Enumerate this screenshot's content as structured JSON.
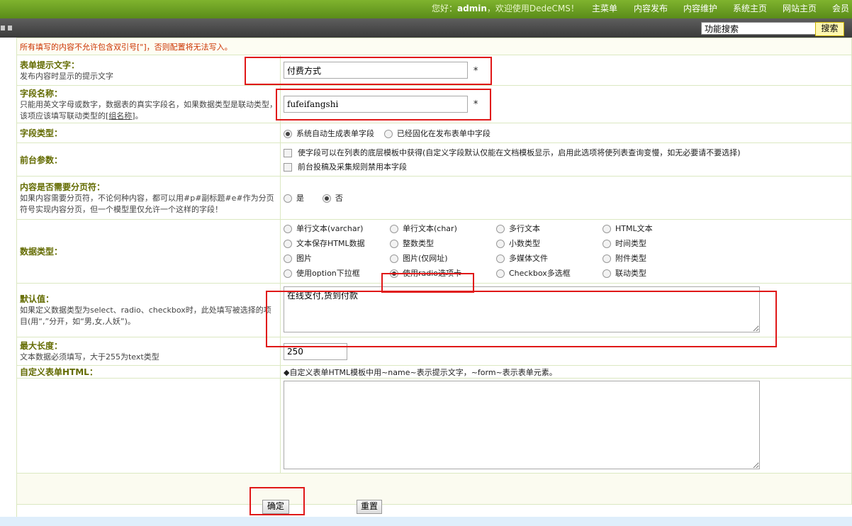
{
  "header": {
    "greeting_prefix": "您好：",
    "username": "admin",
    "greeting_suffix": "，欢迎使用DedeCMS！",
    "nav": [
      "主菜单",
      "内容发布",
      "内容维护",
      "系统主页",
      "网站主页",
      "会员"
    ]
  },
  "toolbar": {
    "search_value": "功能搜索",
    "search_button": "搜索"
  },
  "form": {
    "warning": "所有填写的内容不允许包含双引号[\"]，否则配置将无法写入。",
    "itemname": {
      "title": "表单提示文字：",
      "desc": "发布内容时显示的提示文字",
      "value": "付费方式",
      "required": "*"
    },
    "fieldname": {
      "title": "字段名称：",
      "desc": "只能用英文字母或数字，数据表的真实字段名，如果数据类型是联动类型，该项应该填写联动类型的",
      "desc_link": "[组名称]",
      "desc_end": "。",
      "value": "fufeifangshi",
      "required": "*"
    },
    "fieldtype": {
      "title": "字段类型：",
      "options": [
        "系统自动生成表单字段",
        "已经固化在发布表单中字段"
      ],
      "selected": 0
    },
    "frontparams": {
      "title": "前台参数：",
      "options": [
        "使字段可以在列表的底层模板中获得(自定义字段默认仅能在文档模板显示，启用此选项将使列表查询变慢，如无必要请不要选择)",
        "前台投稿及采集规则禁用本字段"
      ]
    },
    "pagebreak": {
      "title": "内容是否需要分页符：",
      "desc": "如果内容需要分页符，不论何种内容，都可以用#p#副标题#e#作为分页符号实现内容分页，但一个模型里仅允许一个这样的字段！",
      "options": [
        "是",
        "否"
      ],
      "selected": 1
    },
    "datatype": {
      "title": "数据类型：",
      "options": [
        "单行文本(varchar)",
        "单行文本(char)",
        "多行文本",
        "HTML文本",
        "文本保存HTML数据",
        "整数类型",
        "小数类型",
        "时间类型",
        "图片",
        "图片(仅网址)",
        "多媒体文件",
        "附件类型",
        "使用option下拉框",
        "使用radio选项卡",
        "Checkbox多选框",
        "联动类型"
      ],
      "selected": 13
    },
    "default": {
      "title": "默认值：",
      "desc": "如果定义数据类型为select、radio、checkbox时，此处填写被选择的项目(用“,”分开，如“男,女,人妖”)。",
      "value": "在线支付,货到付款"
    },
    "maxlength": {
      "title": "最大长度：",
      "desc": "文本数据必须填写，大于255为text类型",
      "value": "250"
    },
    "customhtml": {
      "title": "自定义表单HTML：",
      "hint": "◆自定义表单HTML模板中用~name~表示提示文字，~form~表示表单元素。",
      "value": ""
    },
    "buttons": {
      "submit": "确定",
      "reset": "重置"
    }
  },
  "colors": {
    "header_green": "#6fa224",
    "label_olive": "#636b00",
    "warning_red": "#cc3300",
    "highlight_red": "#e01818"
  }
}
